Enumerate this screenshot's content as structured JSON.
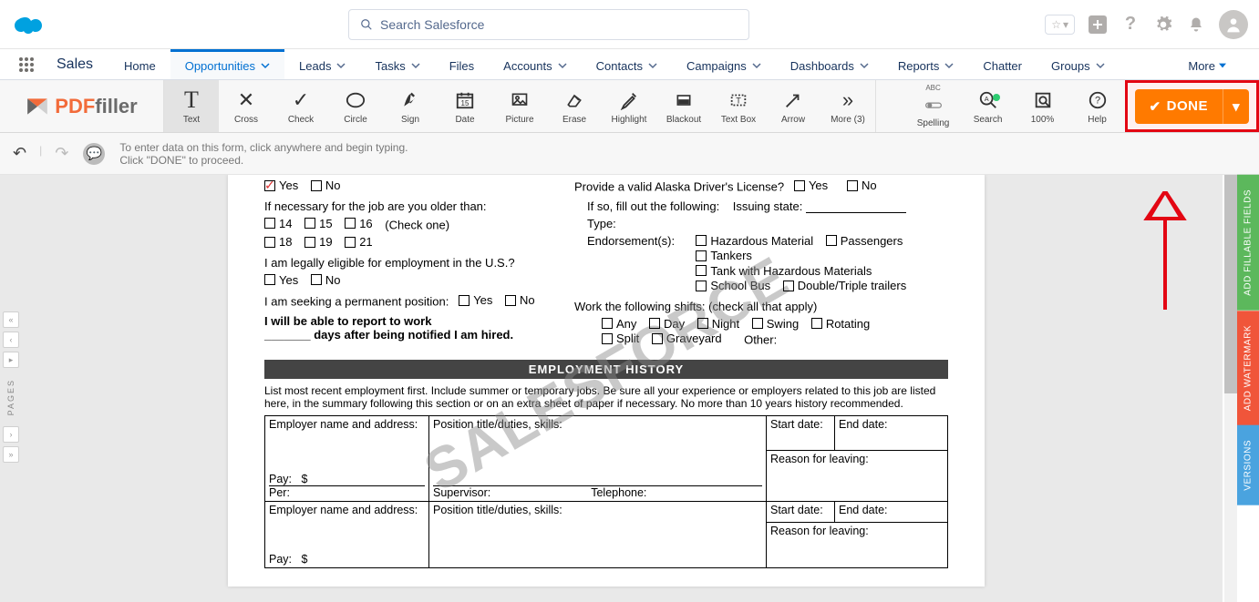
{
  "sf": {
    "search_placeholder": "Search Salesforce",
    "app_name": "Sales",
    "nav": [
      "Home",
      "Opportunities",
      "Leads",
      "Tasks",
      "Files",
      "Accounts",
      "Contacts",
      "Campaigns",
      "Dashboards",
      "Reports",
      "Chatter",
      "Groups"
    ],
    "nav_more": "More"
  },
  "pdffiller": {
    "brand_red": "PDF",
    "brand_grey": "filler",
    "tools": [
      "Text",
      "Cross",
      "Check",
      "Circle",
      "Sign",
      "Date",
      "Picture",
      "Erase",
      "Highlight",
      "Blackout",
      "Text Box",
      "Arrow",
      "More (3)"
    ],
    "right_tools": {
      "spelling": "Spelling",
      "search": "Search",
      "zoom": "100%",
      "help": "Help",
      "spelling_badge": "ABC"
    },
    "done": "DONE",
    "hint_line1": "To enter data on this form, click anywhere and begin typing.",
    "hint_line2": "Click \"DONE\" to proceed."
  },
  "side_gutter_label": "PAGES",
  "side_tabs": {
    "fill": "ADD FILLABLE FIELDS",
    "wm": "ADD WATERMARK",
    "ver": "VERSIONS"
  },
  "form": {
    "yes": "Yes",
    "no": "No",
    "q_older": "If necessary for the job are you older than:",
    "ages": [
      "14",
      "15",
      "16",
      "18",
      "19",
      "21"
    ],
    "check_one": "(Check one)",
    "q_eligible": "I am legally eligible for employment in the U.S.?",
    "q_permanent": "I am seeking a permanent position:",
    "report_l1": "I will be able to report to work",
    "report_l2": "_______ days after being notified I am hired.",
    "q_license": "Provide a valid Alaska Driver's License?",
    "issuing_prefix": "If so, fill out the following:",
    "issuing_state": "Issuing state:",
    "type": "Type:",
    "endorsements": "Endorsement(s):",
    "end_opts": [
      "Hazardous Material",
      "Passengers",
      "Tankers",
      "Tank with Hazardous Materials",
      "School Bus",
      "Double/Triple trailers"
    ],
    "shifts_q": "Work the following shifts: (check all that apply)",
    "shift_opts": [
      "Any",
      "Day",
      "Night",
      "Swing",
      "Rotating",
      "Split",
      "Graveyard"
    ],
    "other": "Other:",
    "section": "EMPLOYMENT HISTORY",
    "instr": "List most recent employment first. Include summer or temporary jobs. Be sure all your experience or employers related to this job are listed here, in the summary following this section or on an extra sheet of paper if necessary. No more than 10 years history recommended.",
    "emp_name": "Employer name and address:",
    "position": "Position title/duties, skills:",
    "start": "Start date:",
    "end": "End date:",
    "reason": "Reason for leaving:",
    "pay": "Pay:",
    "pay_val": "$",
    "per": "Per:",
    "supervisor": "Supervisor:",
    "telephone": "Telephone:",
    "watermark": "SALESFORCE"
  }
}
